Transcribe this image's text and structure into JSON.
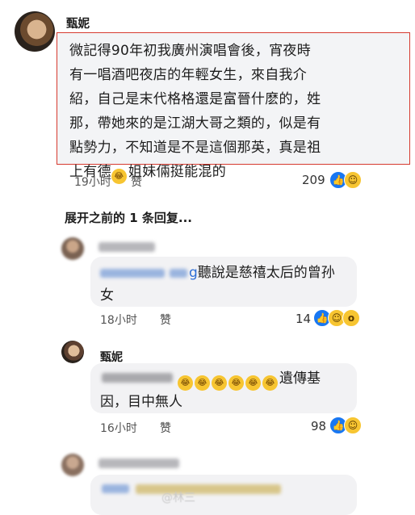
{
  "post": {
    "author": "甄妮",
    "text_lines": [
      "微記得90年初我廣州演唱會後，宵夜時",
      "有一唱酒吧夜店的年輕女生，來自我介",
      "紹，自己是末代格格還是富晉什麽的，姓",
      "那，帶她來的是江湖大哥之類的，似是有",
      "點勢力，不知道是不是這個那英，真是祖"
    ],
    "last_line_pre": "上有德",
    "last_line_post": "姐妹倆挺能混的",
    "time": "19小时",
    "like_label": "赞",
    "reaction_count": "209"
  },
  "expand_replies": "展开之前的 1 条回复...",
  "reply1": {
    "mention_suffix": "g",
    "text_line1": "聽說是慈禧太后的曾孙",
    "text_line2": "女",
    "time": "18小时",
    "like_label": "赞",
    "reaction_count": "14"
  },
  "reply2": {
    "author": "甄妮",
    "text_suffix": "遺傳基",
    "text_line2": "因，目中無人",
    "emoji_count_label": "6",
    "time": "16小时",
    "like_label": "赞",
    "reaction_count": "98"
  },
  "reply3": {
    "watermark": "@林三"
  },
  "icons": {
    "like": "thumbs-up-icon",
    "haha": "laughing-face-icon",
    "wow": "surprised-face-icon",
    "rofl": "rolling-laughing-emoji"
  },
  "colors": {
    "highlight_border": "#d63a2f",
    "like_blue": "#1877f2",
    "mention_blue": "#2f6fd6"
  }
}
